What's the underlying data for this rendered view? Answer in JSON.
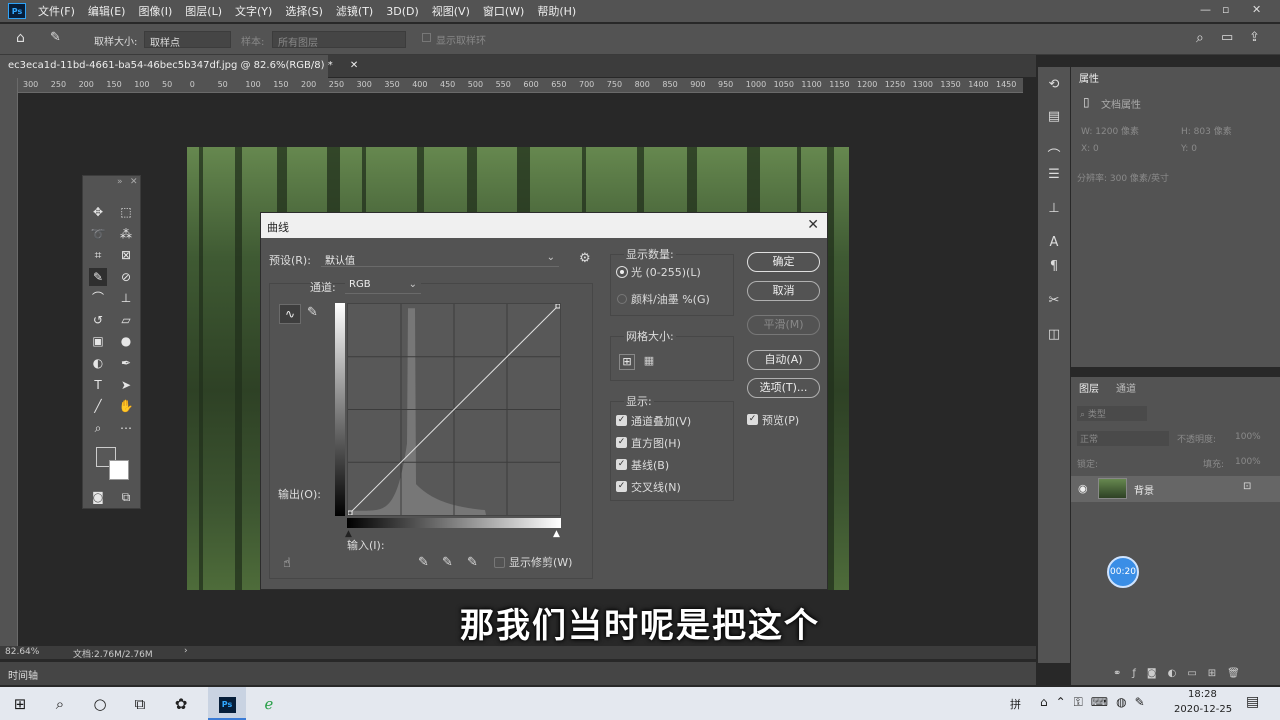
{
  "menubar": {
    "app_icon": "Ps",
    "items": [
      "文件(F)",
      "编辑(E)",
      "图像(I)",
      "图层(L)",
      "文字(Y)",
      "选择(S)",
      "滤镜(T)",
      "3D(D)",
      "视图(V)",
      "窗口(W)",
      "帮助(H)"
    ],
    "window_controls": [
      "—",
      "▫",
      "✕"
    ]
  },
  "options": {
    "sample_size_label": "取样大小:",
    "sample_size_value": "取样点",
    "sample_label": "样本:",
    "sample_value": "所有图层",
    "show_ring_label": "显示取样环"
  },
  "document": {
    "tab_title": "ec3eca1d-11bd-4661-ba54-46bec5b347df.jpg @ 82.6%(RGB/8) *",
    "tab_close": "✕",
    "ruler_ticks": [
      "300",
      "250",
      "200",
      "150",
      "100",
      "50",
      "0",
      "50",
      "100",
      "150",
      "200",
      "250",
      "300",
      "350",
      "400",
      "450",
      "500",
      "550",
      "600",
      "650",
      "700",
      "750",
      "800",
      "850",
      "900",
      "950",
      "1000",
      "1050",
      "1100",
      "1150",
      "1200",
      "1250",
      "1300",
      "1350",
      "1400",
      "1450"
    ],
    "zoom": "82.64%",
    "doc_size": "文档:2.76M/2.76M",
    "status_arrow": "›",
    "timeline_label": "时间轴"
  },
  "properties_panel": {
    "tab": "属性",
    "section": "文档属性",
    "width": "W:  1200 像素",
    "height": "H:  803 像素",
    "x": "X:  0",
    "y": "Y:  0",
    "resolution": "分辨率: 300 像素/英寸"
  },
  "layers_panel": {
    "tabs": [
      "图层",
      "通道"
    ],
    "filter_type": "类型",
    "blend_mode": "正常",
    "opacity_label": "不透明度:",
    "opacity_value": "100%",
    "lock_label": "锁定:",
    "fill_label": "填充:",
    "fill_value": "100%",
    "layers": [
      {
        "name": "背景",
        "visible": true,
        "locked": true
      }
    ]
  },
  "curves_dialog": {
    "title": "曲线",
    "close": "✕",
    "preset_label": "预设(R):",
    "preset_value": "默认值",
    "channel_label": "通道:",
    "channel_value": "RGB",
    "output_label": "输出(O):",
    "input_label": "输入(I):",
    "show_clipping_label": "显示修剪(W)",
    "show_amount_title": "显示数量:",
    "show_amount_options": [
      {
        "label": "光 (0-255)(L)",
        "selected": true
      },
      {
        "label": "颜料/油墨 %(G)",
        "selected": false
      }
    ],
    "grid_size_title": "网格大小:",
    "show_title": "显示:",
    "show_options": [
      {
        "label": "通道叠加(V)",
        "checked": true
      },
      {
        "label": "直方图(H)",
        "checked": true
      },
      {
        "label": "基线(B)",
        "checked": true
      },
      {
        "label": "交叉线(N)",
        "checked": true
      }
    ],
    "buttons": {
      "ok": "确定",
      "cancel": "取消",
      "smooth": "平滑(M)",
      "auto": "自动(A)",
      "options": "选项(T)..."
    },
    "preview_label": "预览(P)",
    "preview_checked": true,
    "histogram_peak_fraction": 0.3
  },
  "subtitle": "那我们当时呢是把这个",
  "timer": "00:20",
  "taskbar": {
    "ime": "拼",
    "time": "18:28",
    "date": "2020-12-25"
  },
  "colors": {
    "ps_panel": "#535353",
    "ps_dark": "#282828",
    "accent_blue": "#31a8ff"
  }
}
